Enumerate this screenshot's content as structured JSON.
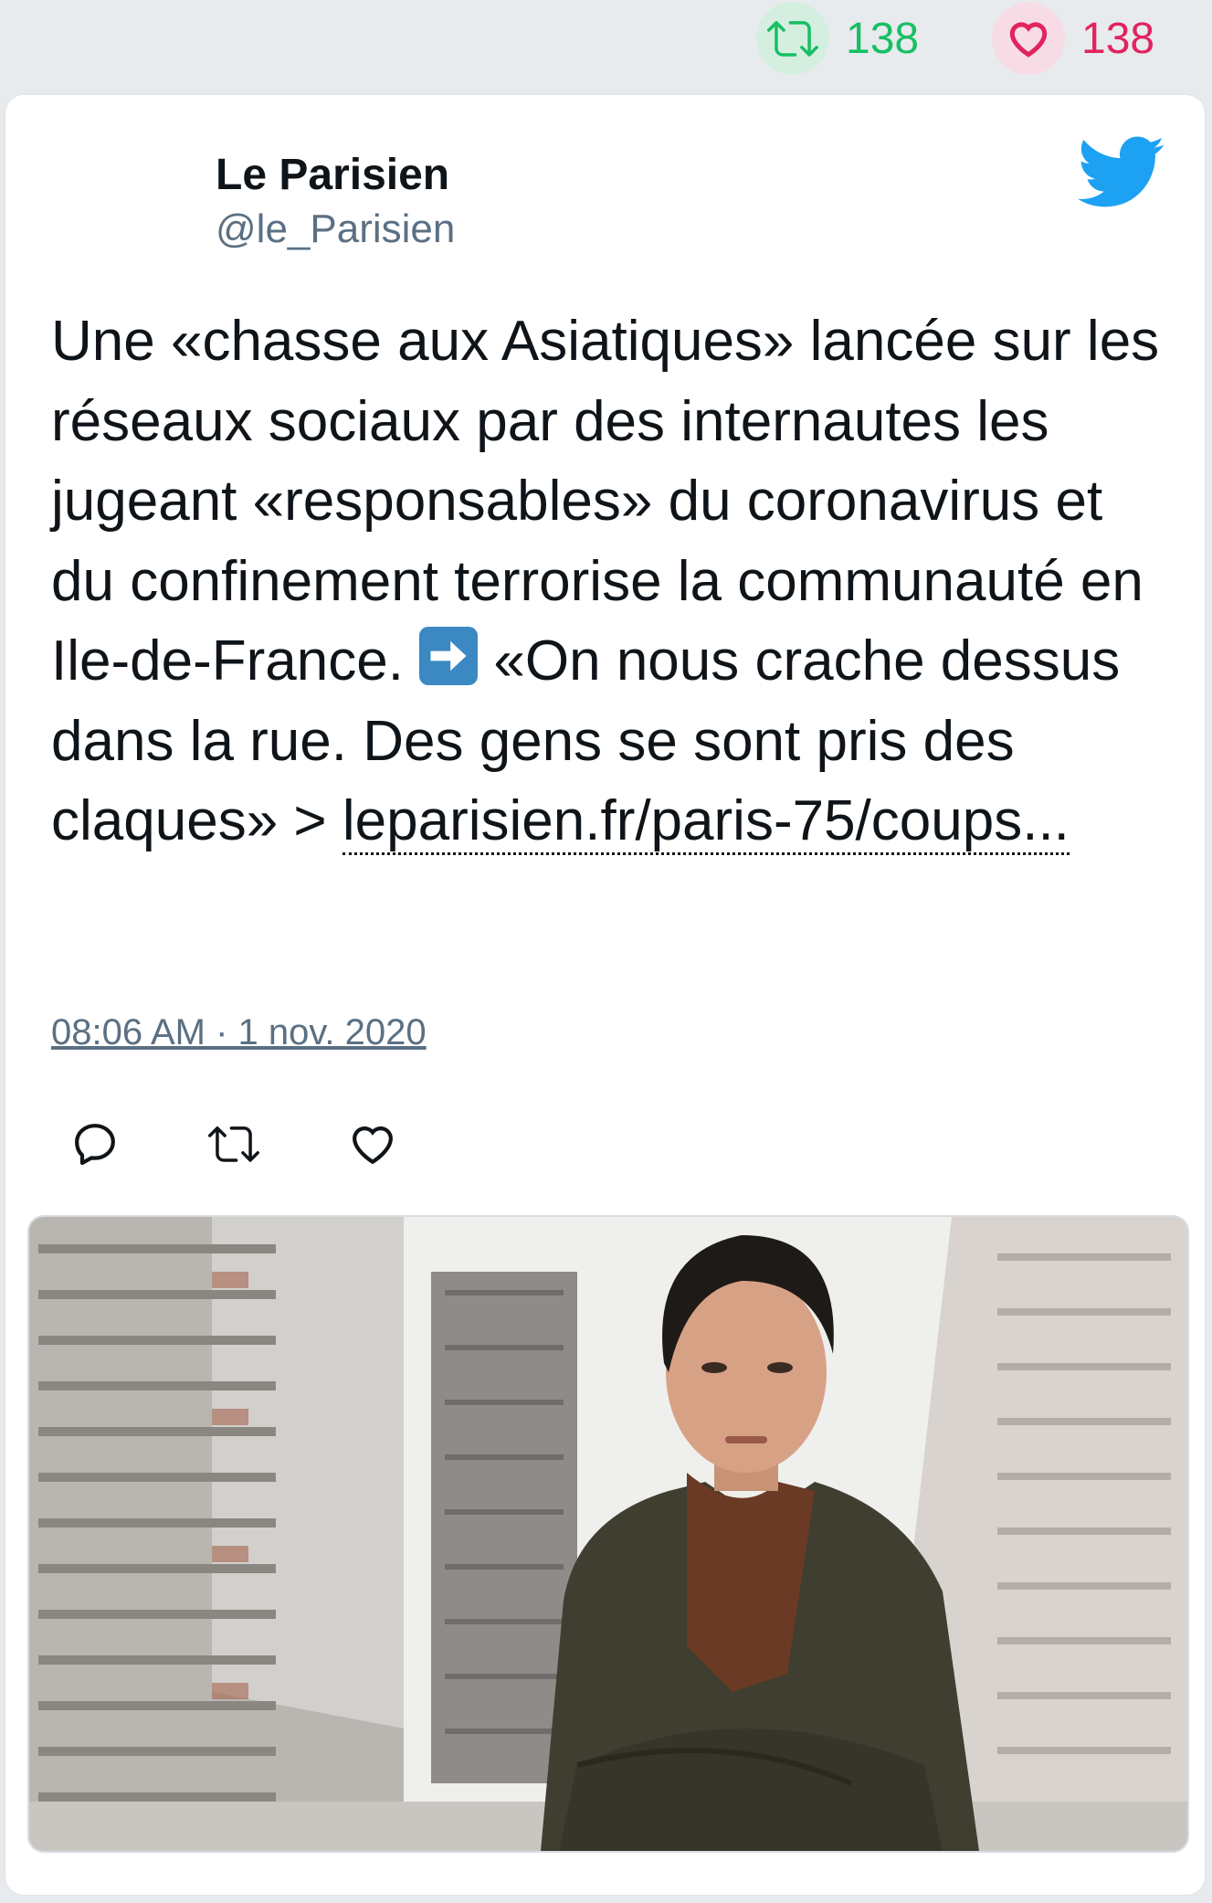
{
  "top_stats": {
    "retweets": "138",
    "likes": "138",
    "retweet_icon": "retweet-icon",
    "like_icon": "heart-icon",
    "retweet_color": "#17bf63",
    "like_color": "#e0245e"
  },
  "tweet": {
    "author_name": "Le Parisien",
    "author_handle": "@le_Parisien",
    "text_before_emoji": "Une «chasse aux Asiatiques» lancée sur les réseaux sociaux par des internautes les jugeant «responsables» du coronavirus et du confinement terrorise la communauté en Ile-de-France.",
    "emoji": "right-arrow-emoji",
    "text_after_emoji": "«On nous crache dessus dans la rue. Des gens se sont pris des claques» >",
    "link": "leparisien.fr/paris-75/coups...",
    "timestamp": "08:06 AM · 1 nov. 2020",
    "brand_icon": "twitter-bird-icon",
    "brand_color": "#1da1f2"
  },
  "actions": {
    "reply_icon": "reply-icon",
    "retweet_icon": "retweet-icon",
    "like_icon": "heart-icon"
  },
  "media": {
    "description_icon": "photo-image"
  }
}
